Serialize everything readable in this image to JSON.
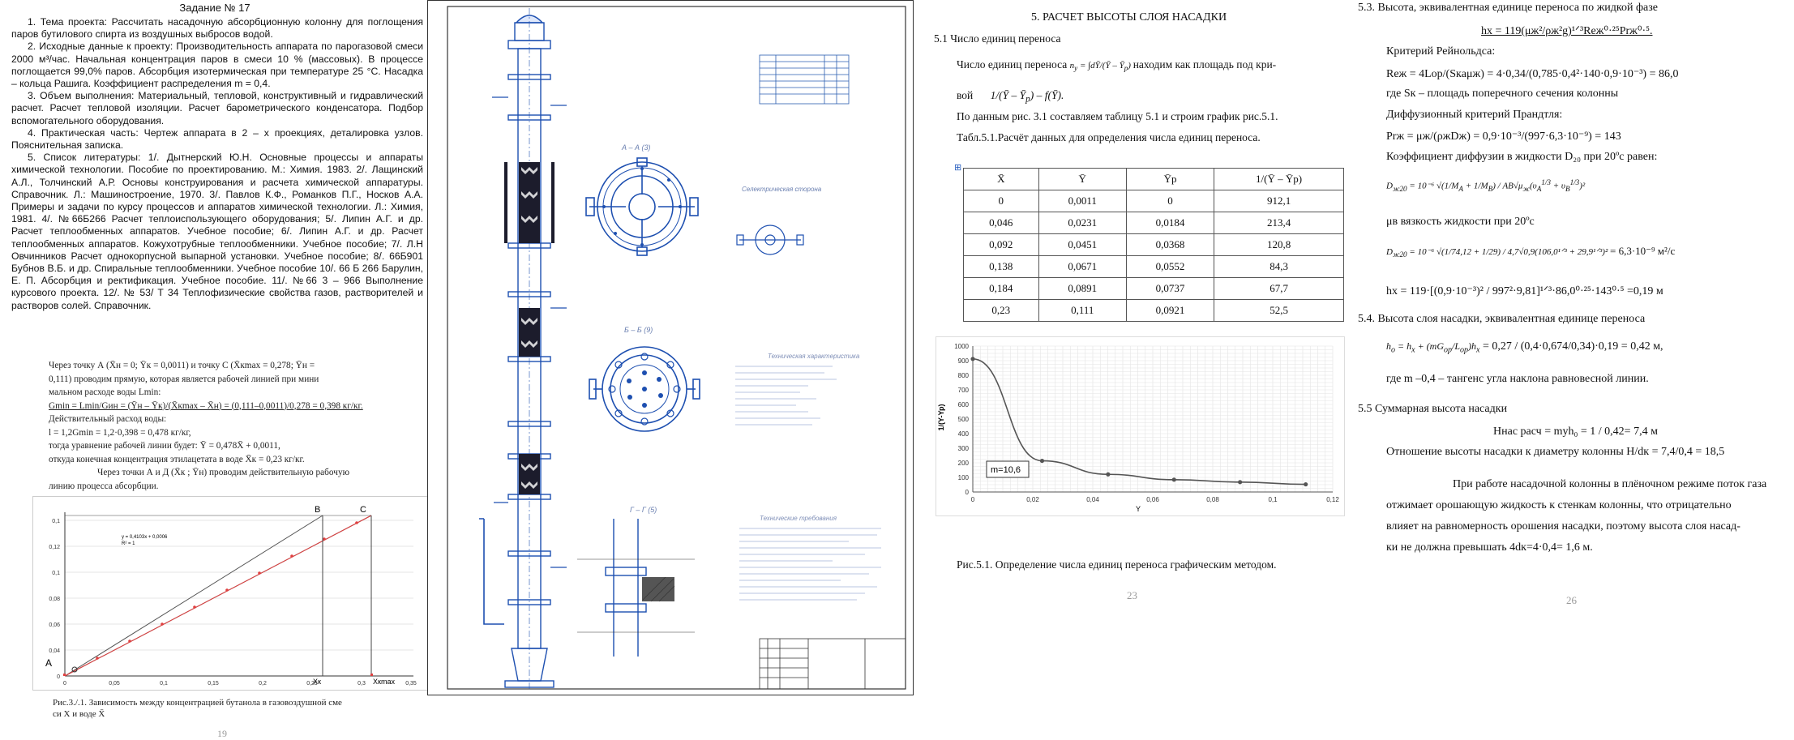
{
  "left_page": {
    "title": "Задание № 17",
    "paragraphs": [
      "1. Тема проекта: Рассчитать насадочную абсорбционную колонну для поглощения паров бутилового спирта из воздушных выбросов водой.",
      "2. Исходные данные к проекту: Производительность аппарата по парогазовой смеси 2000 м³/час. Начальная концентрация паров в смеси 10 % (массовых). В процессе поглощается 99,0% паров. Абсорбция изотермическая при температуре 25 °С. Насадка – кольца Рашига. Коэффициент распределения m = 0,4.",
      "3. Объем выполнения: Материальный, тепловой, конструктивный и гидравлический расчет. Расчет тепловой изоляции. Расчет барометрического конденсатора. Подбор вспомогательного оборудования.",
      "4. Практическая часть: Чертеж аппарата в 2 – х проекциях, деталировка узлов. Пояснительная записка.",
      "5. Список литературы: 1/. Дытнерский Ю.Н. Основные процессы и аппараты химической технологии. Пособие по проектированию. М.: Химия. 1983. 2/. Лащинский А.Л., Толчинский А.Р. Основы конструирования и расчета химической аппаратуры. Справочник. Л.: Машиностроение, 1970. 3/. Павлов К.Ф., Романков П.Г., Носков А.А. Примеры и задачи по курсу процессов и аппаратов химической технологии. Л.: Химия, 1981. 4/. №66Б266 Расчет теплоиспользующего оборудования; 5/. Липин А.Г. и др. Расчет теплообменных аппаратов. Учебное пособие; 6/. Липин А.Г. и др. Расчет теплообменных аппаратов. Кожухотрубные теплообменники. Учебное пособие; 7/. Л.Н Овчинников Расчет однокорпусной выпарной установки. Учебное пособие; 8/. 66Б901 Бубнов В.Б. и др. Спиральные теплообменники. Учебное пособие 10/. 66 Б 266 Барулин, Е. П. Абсорбция и ректификация. Учебное пособие. 11/. №66 3 – 966 Выполнение курсового проекта. 12/. № 53/ Т 34 Теплофизические свойства газов, растворителей и растворов солей. Справочник."
    ],
    "mid_lines": [
      "Через точку А (X̄н = 0; Ȳк = 0,0011) и точку С (X̄кmax = 0,278; Ȳн =",
      "0,111) проводим прямую, которая является рабочей линией при мини",
      "мальном расходе воды Lmin:",
      "Gmin = Lmin/Gин = (Ȳн – Ȳк)/(X̄кmax – X̄н) = (0,111–0,0011)/0,278 = 0,398 кг/кг.",
      "Действительный расход воды:",
      "l = 1,2Gmin = 1,2·0,398 = 0,478 кг/кг,",
      "тогда уравнение рабочей линии будет:    Ȳ = 0,478X̄ + 0,0011,",
      "откуда конечная концентрация этилацетата в воде X̄к = 0,23 кг/кг.",
      "Через точки А и Д (X̄к ; Ȳн) проводим действительную рабочую",
      "линию процесса абсорбции."
    ],
    "graph": {
      "y_ticks": [
        "0,1",
        "0,12",
        "0,1",
        "0,08",
        "0,06",
        "0,04",
        "0,02",
        "0"
      ],
      "x_ticks": [
        "0",
        "0,05",
        "0,1",
        "0,15",
        "0,2",
        "0,25",
        "0,3",
        "0,35"
      ],
      "eq1": "y = 0,4103x + 0,0006",
      "eq2": "R² = 1",
      "labels": {
        "a": "A",
        "b": "B",
        "c": "C",
        "xk": "Xк",
        "xkmax": "Xкmax"
      }
    },
    "caption_lines": [
      "Рис.3./.1. Зависимость между концентрацией бутанола в газовоздушной сме",
      "си X и воде X̄"
    ],
    "page_number": "19"
  },
  "drawing": {
    "view_a": "А – А (3)",
    "view_b": "Б – Б (9)",
    "view_c": "Г – Г (5)",
    "label_small": "Селектрическая сторона",
    "tech_title": "Технические требования",
    "tech_title2": "Техническая характеристика"
  },
  "page23": {
    "heading": "5.   РАСЧЕТ ВЫСОТЫ СЛОЯ НАСАДКИ",
    "sub": "5.1  Число единиц переноса",
    "line1a": "Число единиц переноса",
    "line1b": "находим как площадь под кри-",
    "line2a": "вой",
    "line3": "По данным рис. 3.1 составляем таблицу 5.1 и строим график рис.5.1.",
    "line4": "Табл.5.1.Расчёт данных для определения числа единиц переноса.",
    "table": {
      "headers": [
        "X̄",
        "Ȳ",
        "Ȳр",
        "1/(Ȳ – Ȳр)"
      ],
      "rows": [
        [
          "0",
          "0,0011",
          "0",
          "912,1"
        ],
        [
          "0,046",
          "0,0231",
          "0,0184",
          "213,4"
        ],
        [
          "0,092",
          "0,0451",
          "0,0368",
          "120,8"
        ],
        [
          "0,138",
          "0,0671",
          "0,0552",
          "84,3"
        ],
        [
          "0,184",
          "0,0891",
          "0,0737",
          "67,7"
        ],
        [
          "0,23",
          "0,111",
          "0,0921",
          "52,5"
        ]
      ]
    },
    "chart_data": {
      "type": "line",
      "x": [
        0,
        0.0231,
        0.0451,
        0.0671,
        0.0891,
        0.111
      ],
      "series": [
        {
          "values": [
            912.1,
            213.4,
            120.8,
            84.3,
            67.7,
            52.5
          ]
        }
      ],
      "ylabel": "1/(Y-Yp)",
      "xlabel": "Y",
      "xlim": [
        0,
        0.12
      ],
      "ylim": [
        0,
        1000
      ],
      "x_ticks": [
        "0",
        "0,02",
        "0,04",
        "0,06",
        "0,08",
        "0,1",
        "0,12"
      ],
      "y_ticks": [
        "0",
        "100",
        "200",
        "300",
        "400",
        "500",
        "600",
        "700",
        "800",
        "900",
        "1000"
      ],
      "annotation": "m=10,6",
      "grid": true
    },
    "caption": "Рис.5.1. Определение числа единиц переноса графическим методом.",
    "page_number": "23"
  },
  "page26": {
    "l1": "5.3.   Высота, эквивалентная единице переноса по жидкой фазе",
    "l2": "hx = 119(μж²/ρж²g)¹ᐟ³Reж⁰·²⁵Prж⁰·⁵.",
    "l3": "Критерий Рейнольдса:",
    "l4": "Reж = 4Lор/(Sкaμж) = 4·0,34/(0,785·0,4²·140·0,9·10⁻³) = 86,0",
    "l5": "где Sк – площадь поперечного сечения колонны",
    "l6": "Диффузионный критерий Прандтля:",
    "l7": "Prж = μж/(ρжDж) = 0,9·10⁻³/(997·6,3·10⁻⁹) = 143",
    "l8": "Коэффициент диффузии в жидкости  D₂₀  при 20ºс равен:",
    "l9": "μв    вязкость жидкости при 20ºс",
    "l10": "= 6,3·10⁻⁹ м²/с",
    "l11": "hx = 119·[(0,9·10⁻³)² / 997²·9,81]¹ᐟ³·86,0⁰·²⁵·143⁰·⁵ =0,19 м",
    "l12": "5.4. Высота слоя насадки, эквивалентная единице переноса",
    "l13": "= 0,27 / (0,4·0,674/0,34)·0,19 = 0,42 м,",
    "l14": "где m –0,4 – тангенс угла наклона равновесной линии.",
    "l15": "5.5     Суммарная высота насадки",
    "l16": "Hнас расч = myh₀ = 1 / 0,42= 7,4 м",
    "l17": "Отношение высоты насадки к диаметру колонны H/dк =  7,4/0,4 = 18,5",
    "l18": "При работе насадочной колонны в плёночном режиме поток газа",
    "l19": "отжимает орошающую жидкость к стенкам колонны, что отрицательно",
    "l20": "влияет на равномерность орошения насадки, поэтому высота слоя насад-",
    "l21": "ки не должна превышать 4dк=4·0,4= 1,6 м.",
    "page_number": "26"
  }
}
